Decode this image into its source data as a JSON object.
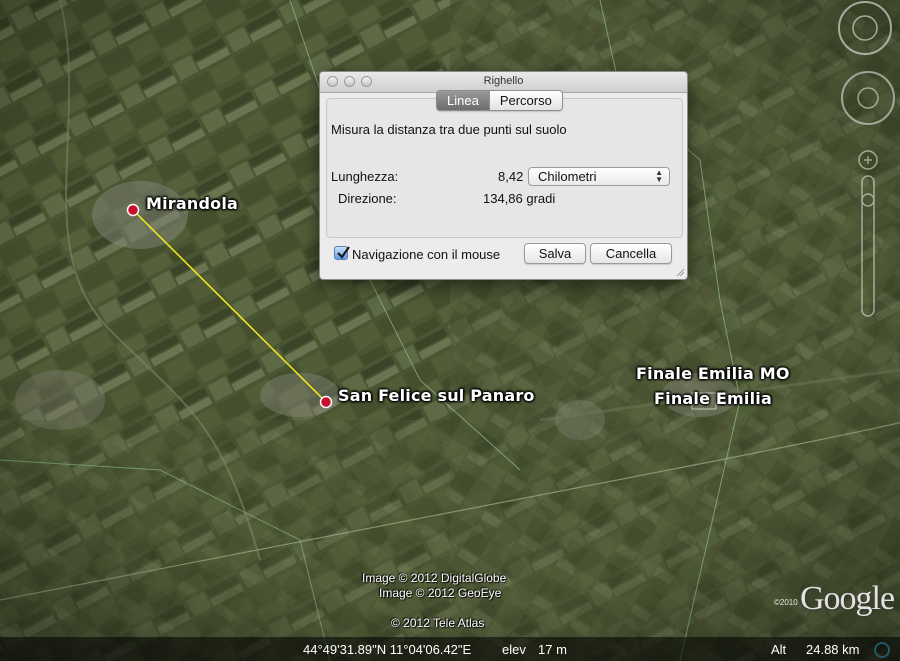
{
  "map": {
    "places": [
      {
        "name": "Mirandola"
      },
      {
        "name": "San Felice sul Panaro"
      },
      {
        "name": "Finale Emilia MO"
      },
      {
        "name": "Finale Emilia"
      }
    ],
    "credits": {
      "digitalglobe": "Image © 2012 DigitalGlobe",
      "geoeye": "Image © 2012 GeoEye",
      "teleatlas": "© 2012 Tele Atlas"
    },
    "brand": {
      "copyright": "©2010",
      "logo": "Google"
    },
    "ruler_line_color": "#f2ee1a",
    "marker_color": "#c8102e"
  },
  "statusbar": {
    "coords": "44°49'31.89\"N  11°04'06.42\"E",
    "elev_label": "elev",
    "elev_value": "17 m",
    "alt_label": "Alt",
    "alt_value": "24.88 km"
  },
  "dialog": {
    "title": "Righello",
    "tabs": [
      {
        "label": "Linea",
        "active": true
      },
      {
        "label": "Percorso",
        "active": false
      }
    ],
    "description": "Misura la distanza tra due punti sul suolo",
    "length_label": "Lunghezza:",
    "length_value": "8,42",
    "unit_selected": "Chilometri",
    "direction_label": "Direzione:",
    "direction_value": "134,86 gradi",
    "mouse_nav_label": "Navigazione con il mouse",
    "mouse_nav_checked": true,
    "save_label": "Salva",
    "cancel_label": "Cancella"
  }
}
